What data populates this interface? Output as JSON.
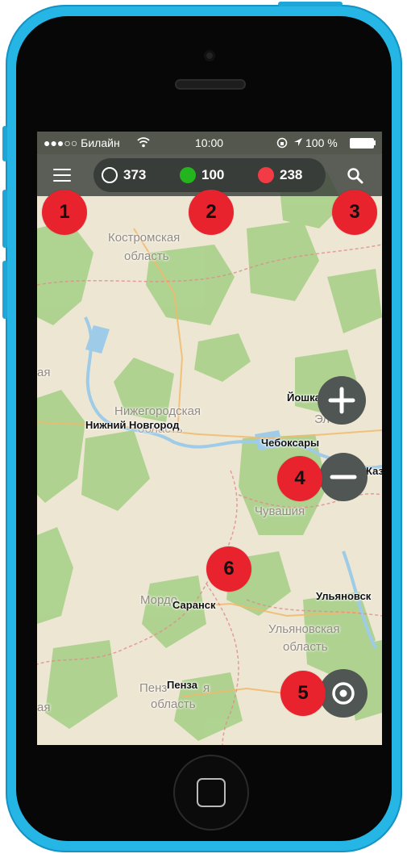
{
  "status_bar": {
    "carrier": "●●●○○ Билайн",
    "time": "10:00",
    "battery": "100 %"
  },
  "counters": [
    {
      "value": "373",
      "color": "outline"
    },
    {
      "value": "100",
      "color": "#24b51e"
    },
    {
      "value": "238",
      "color": "#f23b44"
    }
  ],
  "map_labels": {
    "kostroma_1": "Костромская",
    "kostroma_2": "область",
    "nizhny_region": "Нижегородская",
    "nizhny_region_2": "область",
    "nizhny_city": "Нижний Новгород",
    "cheboksary": "Чебоксары",
    "yoshkar": "Йошкар",
    "yoshkar_2": "Эл",
    "kaz": "Каз",
    "chuvashia": "Чувашия",
    "mordovia": "Мордо",
    "saransk": "Саранск",
    "ulyanovsk": "Ульяновск",
    "ulyanovsk_region_1": "Ульяновская",
    "ulyanovsk_region_2": "область",
    "penza_region_1": "Пенз",
    "penza_city": "Пенза",
    "penza_region_2": "область",
    "edge_left_1": "ая",
    "edge_left_2": "ая",
    "edge_right_1": "я"
  },
  "markers": [
    "1",
    "2",
    "3",
    "4",
    "5",
    "6"
  ],
  "icons": {
    "menu": "hamburger-icon",
    "search": "search-icon",
    "zoom_in": "plus-icon",
    "zoom_out": "minus-icon",
    "locate": "target-icon"
  },
  "colors": {
    "phone_shell": "#25b6e6",
    "marker": "#e8232d",
    "forest": "#a9d08a",
    "map_base": "#ece6d3"
  }
}
